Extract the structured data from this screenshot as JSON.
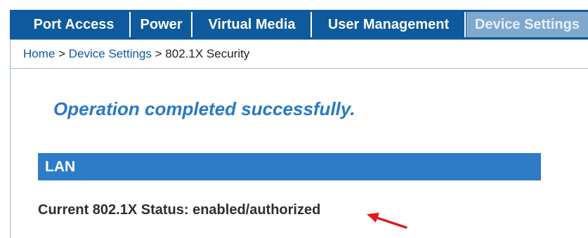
{
  "nav": {
    "tabs": [
      {
        "label": "Port Access"
      },
      {
        "label": "Power"
      },
      {
        "label": "Virtual Media"
      },
      {
        "label": "User Management"
      },
      {
        "label": "Device Settings",
        "active": true
      }
    ]
  },
  "breadcrumb": {
    "home": "Home",
    "separator": ">",
    "section": "Device Settings",
    "current": "802.1X Security"
  },
  "message": {
    "success": "Operation completed successfully."
  },
  "lan": {
    "header": "LAN",
    "status_label": "Current 802.1X Status:",
    "status_value": "enabled/authorized"
  },
  "colors": {
    "nav_bg": "#0e5a9c",
    "active_tab_bg": "#7fa8cf",
    "section_header_bg": "#2e7cc6",
    "success_text": "#2879c3",
    "link": "#0f57a6",
    "annotation_arrow": "#e0191f"
  }
}
